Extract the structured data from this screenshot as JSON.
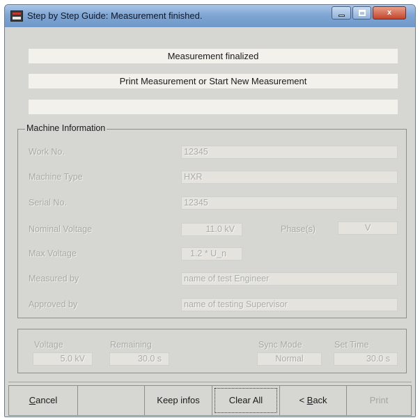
{
  "window": {
    "title": "Step by Step Guide: Measurement finished.",
    "controls": {
      "minimize": "",
      "maximize": "",
      "close": "x"
    }
  },
  "messages": {
    "line1": "Measurement finalized",
    "line2": "Print Measurement or Start New Measurement",
    "line3": ""
  },
  "machine_info": {
    "legend": "Machine Information",
    "work_no": {
      "label": "Work No.",
      "value": "12345"
    },
    "machine_type": {
      "label": "Machine Type",
      "value": "HXR"
    },
    "serial_no": {
      "label": "Serial No.",
      "value": "12345"
    },
    "nominal_voltage": {
      "label": "Nominal Voltage",
      "value": "11.0 kV"
    },
    "phases": {
      "label": "Phase(s)",
      "value": "V"
    },
    "max_voltage": {
      "label": "Max Voltage",
      "value": "1.2 * U_n"
    },
    "measured_by": {
      "label": "Measured by",
      "value": "name of test Engineer"
    },
    "approved_by": {
      "label": "Approved by",
      "value": "name of testing Supervisor"
    }
  },
  "status": {
    "voltage": {
      "label": "Voltage",
      "value": "5.0 kV"
    },
    "remaining": {
      "label": "Remaining",
      "value": "30.0  s"
    },
    "sync_mode": {
      "label": "Sync Mode",
      "value": "Normal"
    },
    "set_time": {
      "label": "Set Time",
      "value": "30.0  s"
    }
  },
  "buttons": {
    "cancel_accel": "C",
    "cancel_rest": "ancel",
    "blank": "",
    "keep_infos": "Keep infos",
    "clear_all": "Clear All",
    "back_prefix": "< ",
    "back_accel": "B",
    "back_rest": "ack",
    "print": "Print"
  }
}
